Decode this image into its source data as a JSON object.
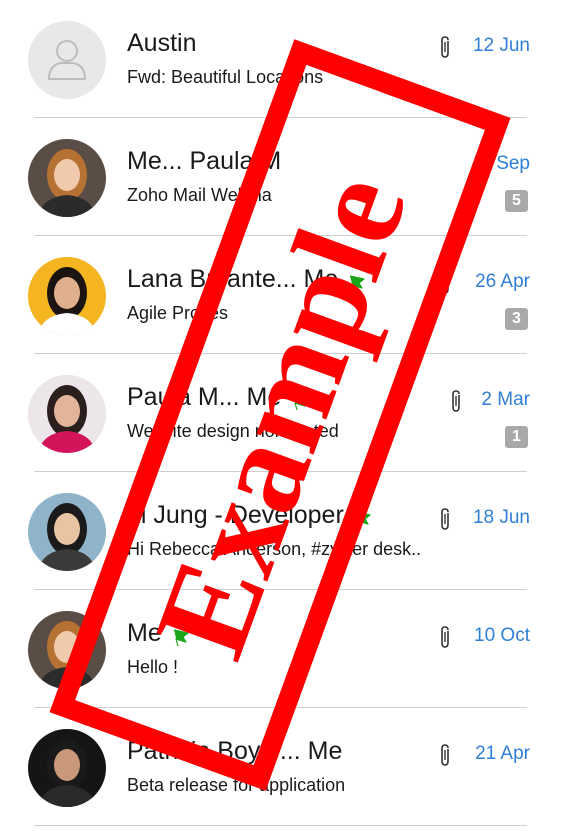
{
  "emails": [
    {
      "sender": "Austin",
      "subject": "Fwd: Beautiful Locations",
      "date": "12 Jun",
      "attachment": true,
      "count": "",
      "flag": false,
      "avatar": "placeholder"
    },
    {
      "sender": "Me... Paula M",
      "subject": "Zoho Mail Webina",
      "date": "7 Sep",
      "attachment": false,
      "count": "5",
      "flag": false,
      "avatar": "photo-woman-blonde"
    },
    {
      "sender": "Lana Bryante... Me",
      "subject": "Agile Proces",
      "date": "26 Apr",
      "attachment": true,
      "count": "3",
      "flag": true,
      "avatar": "photo-woman-yellow"
    },
    {
      "sender": "Paula M... Me",
      "subject": "Website design nominated",
      "date": "2 Mar",
      "attachment": true,
      "count": "1",
      "flag": true,
      "avatar": "photo-woman-pink"
    },
    {
      "sender": "Li Jung - Developer",
      "subject": "Hi Rebecca Anderson, #zylker desk..",
      "date": "18 Jun",
      "attachment": true,
      "count": "",
      "flag": true,
      "avatar": "photo-man-glasses"
    },
    {
      "sender": "Me",
      "subject": "Hello !",
      "date": "10 Oct",
      "attachment": true,
      "count": "",
      "flag": true,
      "avatar": "photo-woman-blonde"
    },
    {
      "sender": "Patricia Boyle... Me",
      "subject": "Beta release for application",
      "date": "21 Apr",
      "attachment": true,
      "count": "",
      "flag": false,
      "avatar": "photo-man-dark"
    }
  ],
  "watermark": {
    "text": "Example"
  },
  "colors": {
    "date": "#2f7fd8",
    "flag": "#1aa51a",
    "badge": "#a9a9a9",
    "watermark": "#ff0000"
  },
  "icons": {
    "attachment": "paperclip-icon",
    "flag": "flag-icon"
  }
}
